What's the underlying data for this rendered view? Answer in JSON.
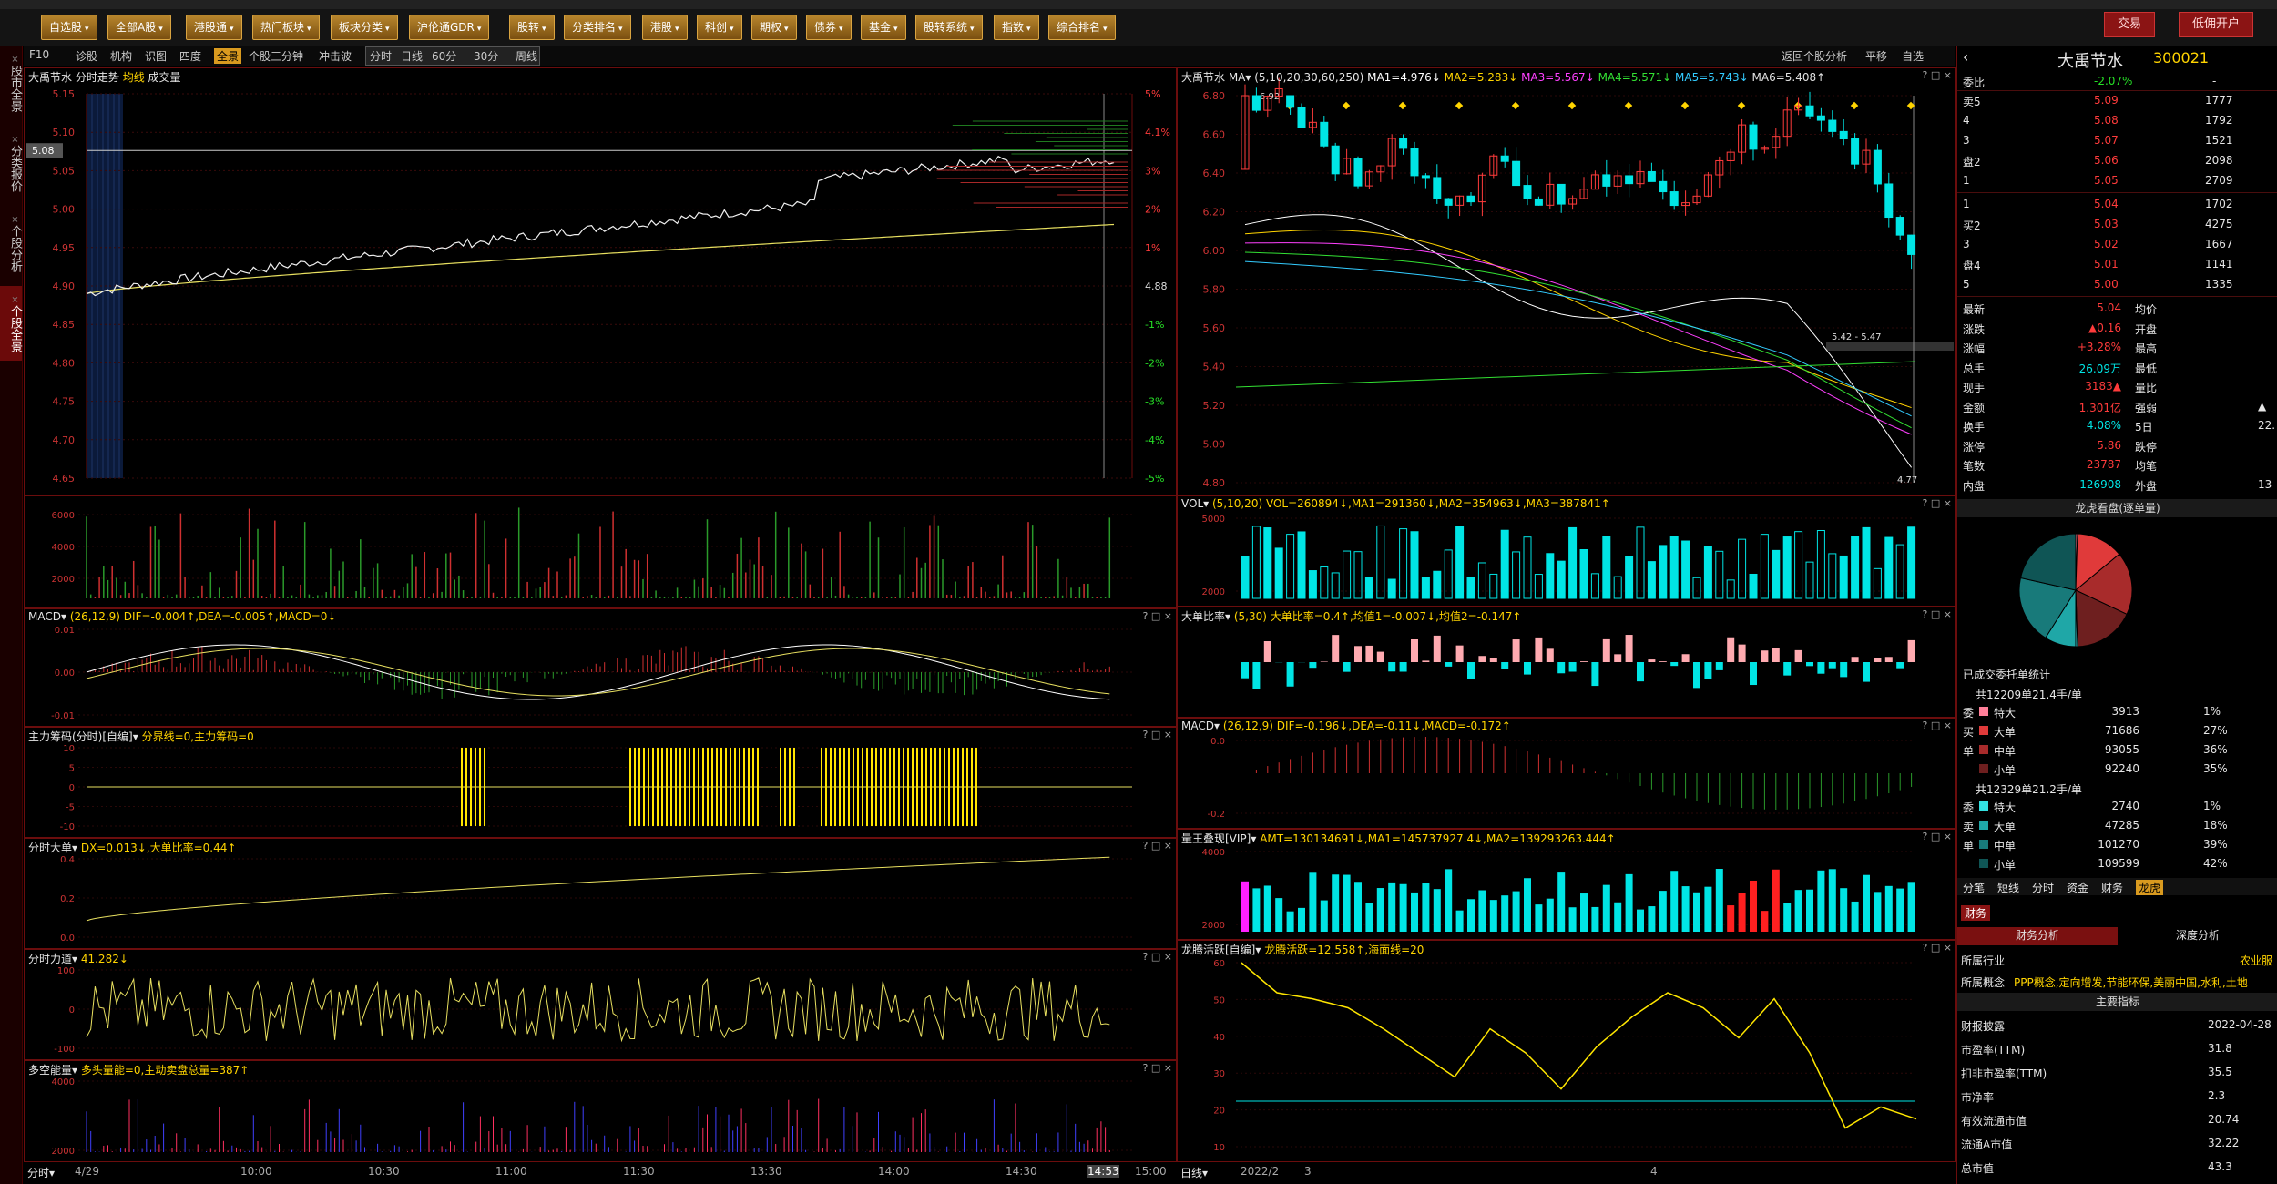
{
  "menubar": {
    "buttons": [
      "自选股",
      "全部A股",
      "港股通",
      "热门板块",
      "板块分类",
      "沪伦通GDR",
      "股转",
      "分类排名",
      "港股",
      "科创",
      "期权",
      "债券",
      "基金",
      "股转系统",
      "指数",
      "综合排名"
    ],
    "trade_label": "交易",
    "open_account_label": "低佣开户"
  },
  "lefttabs": [
    "股市全景",
    "分类报价",
    "个股分析",
    "个股全景"
  ],
  "toolbar": {
    "items": [
      "F10",
      "诊股",
      "机构",
      "识图",
      "四度",
      "全景",
      "个股三分钟",
      "冲击波"
    ],
    "period_items": [
      "分时",
      "日线",
      "60分",
      "30分",
      "周线"
    ],
    "right_items": [
      "返回个股分析",
      "平移",
      "自选"
    ]
  },
  "intraday": {
    "stock_name": "大禹节水",
    "view": "分时走势",
    "legend_avg": "均线",
    "legend_vol": "成交量",
    "price_labels": [
      "5.15",
      "5.10",
      "5.05",
      "5.00",
      "4.95",
      "4.90",
      "4.85",
      "4.80",
      "4.75",
      "4.70",
      "4.65"
    ],
    "pct_labels": [
      "5%",
      "4.1%",
      "3%",
      "2%",
      "1%",
      "4.88",
      "-1%",
      "-2%",
      "-3%",
      "-4%",
      "-5%"
    ],
    "current_price_tag": "5.08",
    "time_labels": [
      "4/29",
      "10:00",
      "10:30",
      "11:00",
      "11:30",
      "13:30",
      "14:00",
      "14:30",
      "14:53",
      "15:00"
    ],
    "bottom_left": "分时",
    "vol_labels": [
      "6000",
      "4000",
      "2000"
    ]
  },
  "intraday_indicators": [
    {
      "title": "MACD",
      "params": "(26,12,9)",
      "values": "DIF=-0.004↑,DEA=-0.005↑,MACD=0↓",
      "labels": [
        "0.01",
        "0.00",
        "-0.01"
      ]
    },
    {
      "title": "主力筹码(分时)[自编]",
      "params": "",
      "values": "分界线=0,主力筹码=0",
      "labels": [
        "10",
        "5",
        "0",
        "-5",
        "-10"
      ]
    },
    {
      "title": "分时大单",
      "params": "",
      "values": "DX=0.013↓,大单比率=0.44↑",
      "labels": [
        "0.4",
        "0.2",
        "0.0"
      ]
    },
    {
      "title": "分时力道",
      "params": "",
      "values": "41.282↓",
      "labels": [
        "100",
        "0",
        "-100"
      ]
    },
    {
      "title": "多空能量",
      "params": "",
      "values": "多头量能=0,主动卖盘总量=387↑",
      "labels": [
        "4000",
        "2000"
      ]
    }
  ],
  "daily": {
    "stock_name": "大禹节水",
    "ma_label": "MA",
    "ma_params": "(5,10,20,30,60,250)",
    "ma_values": [
      "MA1=4.976↓",
      "MA2=5.283↓",
      "MA3=5.567↓",
      "MA4=5.571↓",
      "MA5=5.743↓",
      "MA6=5.408↑"
    ],
    "price_labels": [
      "6.80",
      "6.60",
      "6.40",
      "6.20",
      "6.00",
      "5.80",
      "5.60",
      "5.40",
      "5.20",
      "5.00",
      "4.80"
    ],
    "high_mark": "6.92",
    "low_mark": "4.77",
    "range_label": "5.42 - 5.47",
    "time_labels": [
      "2022/2",
      "3",
      "4"
    ],
    "bottom_left": "日线"
  },
  "daily_indicators": [
    {
      "title": "VOL",
      "params": "(5,10,20)",
      "values": "VOL=260894↓,MA1=291360↓,MA2=354963↓,MA3=387841↑",
      "labels": [
        "5000",
        "2000"
      ]
    },
    {
      "title": "大单比率",
      "params": "(5,30)",
      "values": "大单比率=0.4↑,均值1=-0.007↓,均值2=-0.147↑",
      "labels": []
    },
    {
      "title": "MACD",
      "params": "(26,12,9)",
      "values": "DIF=-0.196↓,DEA=-0.11↓,MACD=-0.172↑",
      "labels": [
        "0.0",
        "-0.2"
      ]
    },
    {
      "title": "量王叠现[VIP]",
      "params": "",
      "values": "AMT=130134691↓,MA1=145737927.4↓,MA2=139293263.444↑",
      "labels": [
        "4000",
        "2000"
      ]
    },
    {
      "title": "龙腾活跃[自编]",
      "params": "",
      "values": "龙腾活跃=12.558↑,海面线=20",
      "labels": [
        "60",
        "50",
        "40",
        "30",
        "20",
        "10"
      ]
    }
  ],
  "info": {
    "name": "大禹节水",
    "code": "300021",
    "weibi_label": "委比",
    "weibi_value": "-2.07%",
    "weibi_count": "-",
    "asks": [
      {
        "label": "卖5",
        "price": "5.09",
        "vol": "1777"
      },
      {
        "label": "4",
        "price": "5.08",
        "vol": "1792"
      },
      {
        "label": "3",
        "price": "5.07",
        "vol": "1521"
      },
      {
        "label": "盘2",
        "price": "5.06",
        "vol": "2098"
      },
      {
        "label": "1",
        "price": "5.05",
        "vol": "2709"
      }
    ],
    "bids": [
      {
        "label": "1",
        "price": "5.04",
        "vol": "1702"
      },
      {
        "label": "买2",
        "price": "5.03",
        "vol": "4275"
      },
      {
        "label": "3",
        "price": "5.02",
        "vol": "1667"
      },
      {
        "label": "盘4",
        "price": "5.01",
        "vol": "1141"
      },
      {
        "label": "5",
        "price": "5.00",
        "vol": "1335"
      }
    ],
    "stats": [
      {
        "l": "最新",
        "v": "5.04",
        "l2": "均价",
        "v2": ""
      },
      {
        "l": "涨跌",
        "v": "▲0.16",
        "l2": "开盘",
        "v2": ""
      },
      {
        "l": "涨幅",
        "v": "+3.28%",
        "l2": "最高",
        "v2": ""
      },
      {
        "l": "总手",
        "v": "26.09万",
        "l2": "最低",
        "v2": ""
      },
      {
        "l": "现手",
        "v": "3183▲",
        "l2": "量比",
        "v2": ""
      },
      {
        "l": "金额",
        "v": "1.301亿",
        "l2": "强弱",
        "v2": "▲"
      },
      {
        "l": "换手",
        "v": "4.08%",
        "l2": "5日",
        "v2": "22."
      },
      {
        "l": "涨停",
        "v": "5.86",
        "l2": "跌停",
        "v2": ""
      },
      {
        "l": "笔数",
        "v": "23787",
        "l2": "均笔",
        "v2": ""
      },
      {
        "l": "内盘",
        "v": "126908",
        "l2": "外盘",
        "v2": "13"
      }
    ],
    "dragon_title": "龙虎看盘(逐单量)",
    "entrust_title": "已成交委托单统计",
    "buy_total": "共12209单21.4手/单",
    "buy_rows": [
      {
        "side": "委",
        "type": "特大",
        "vol": "3913",
        "pct": "1%",
        "color": "#ff7f99"
      },
      {
        "side": "买",
        "type": "大单",
        "vol": "71686",
        "pct": "27%",
        "color": "#e03a3a"
      },
      {
        "side": "单",
        "type": "中单",
        "vol": "93055",
        "pct": "36%",
        "color": "#a82b2b"
      },
      {
        "side": "",
        "type": "小单",
        "vol": "92240",
        "pct": "35%",
        "color": "#6e1f1f"
      }
    ],
    "sell_total": "共12329单21.2手/单",
    "sell_rows": [
      {
        "side": "委",
        "type": "特大",
        "vol": "2740",
        "pct": "1%",
        "color": "#33e0e0"
      },
      {
        "side": "卖",
        "type": "大单",
        "vol": "47285",
        "pct": "18%",
        "color": "#1fa7a7"
      },
      {
        "side": "单",
        "type": "中单",
        "vol": "101270",
        "pct": "39%",
        "color": "#187a7a"
      },
      {
        "side": "",
        "type": "小单",
        "vol": "109599",
        "pct": "42%",
        "color": "#0f5555"
      }
    ],
    "bottom_tabs": [
      "分笔",
      "短线",
      "分时",
      "资金",
      "财务",
      "龙虎"
    ],
    "finance_tab": "财务",
    "sub_tabs": [
      "财务分析",
      "深度分析"
    ],
    "industry_label": "所属行业",
    "industry_value": "农业服",
    "concept_label": "所属概念",
    "concept_value": "PPP概念,定向增发,节能环保,美丽中国,水利,土地",
    "main_index": "主要指标",
    "metrics": [
      {
        "l": "财报披露",
        "v": "2022-04-28"
      },
      {
        "l": "市盈率(TTM)",
        "v": "31.8"
      },
      {
        "l": "扣非市盈率(TTM)",
        "v": "35.5"
      },
      {
        "l": "市净率",
        "v": "2.3"
      },
      {
        "l": "有效流通市值",
        "v": "20.74"
      },
      {
        "l": "流通A市值",
        "v": "32.22"
      },
      {
        "l": "总市值",
        "v": "43.3"
      }
    ]
  }
}
